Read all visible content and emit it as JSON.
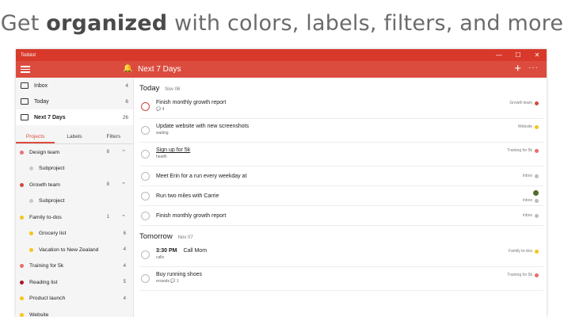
{
  "headline": {
    "pre": "Get ",
    "bold": "organized",
    "post": " with colors, labels, filters, and more"
  },
  "window": {
    "title": "Todoist",
    "controls": [
      "—",
      "☐",
      "✕"
    ]
  },
  "toolbar": {
    "title": "Next 7 Days",
    "add": "+",
    "more": "···"
  },
  "nav": [
    {
      "label": "Inbox",
      "count": "4"
    },
    {
      "label": "Today",
      "count": "6"
    },
    {
      "label": "Next 7 Days",
      "count": "26"
    }
  ],
  "tabs": [
    "Projects",
    "Labels",
    "Filters"
  ],
  "projects": [
    {
      "label": "Design team",
      "count": "8",
      "color": "#e57373",
      "caret": "⌃"
    },
    {
      "label": "Subproject",
      "count": "",
      "color": "#c8c8c8",
      "caret": ""
    },
    {
      "label": "Growth team",
      "count": "8",
      "color": "#d04a3c",
      "caret": "⌃"
    },
    {
      "label": "Subproject",
      "count": "",
      "color": "#c8c8c8",
      "caret": ""
    },
    {
      "label": "Family to-dos",
      "count": "1",
      "color": "#f5c518",
      "caret": "⌃"
    },
    {
      "label": "Grocery list",
      "count": "6",
      "color": "#f5c518",
      "caret": ""
    },
    {
      "label": "Vacation to New Zealand",
      "count": "4",
      "color": "#f5c518",
      "caret": ""
    },
    {
      "label": "Training for 5k",
      "count": "4",
      "color": "#ef6a6a",
      "caret": ""
    },
    {
      "label": "Reading list",
      "count": "5",
      "color": "#a8182b",
      "caret": ""
    },
    {
      "label": "Product launch",
      "count": "4",
      "color": "#f5c518",
      "caret": ""
    },
    {
      "label": "Website",
      "count": "",
      "color": "#f5c518",
      "caret": ""
    }
  ],
  "sections": [
    {
      "title": "Today",
      "date": "Nov 06",
      "tasks": [
        {
          "name": "Finish monthly growth report",
          "sub": "💬 4",
          "project": "Growth team",
          "color": "#d04a3c",
          "priority": true
        },
        {
          "name": "Update website with new screenshots",
          "sub": "waiting",
          "project": "Website",
          "color": "#f5c518"
        },
        {
          "name": "Sign up for 5k",
          "sub": "health",
          "project": "Training for 5k",
          "color": "#ef6a6a",
          "underline": true
        },
        {
          "name": "Meet Erin for a run every weekday at",
          "sub": "",
          "project": "Inbox",
          "color": "#bdbdbd"
        },
        {
          "name": "Run two miles with Carrie",
          "sub": "",
          "project": "Inbox",
          "color": "#bdbdbd",
          "avatar": true
        },
        {
          "name": "Finish monthly growth report",
          "sub": "",
          "project": "Inbox",
          "color": "#bdbdbd"
        }
      ]
    },
    {
      "title": "Tomorrow",
      "date": "Nov 07",
      "tasks": [
        {
          "time": "3:30 PM",
          "name": "Call Mom",
          "sub": "calls",
          "project": "Family to-dos",
          "color": "#f5c518"
        },
        {
          "name": "Buy running shoes",
          "sub": "errands 💬 1",
          "project": "Training for 5k",
          "color": "#ef6a6a"
        }
      ]
    }
  ]
}
